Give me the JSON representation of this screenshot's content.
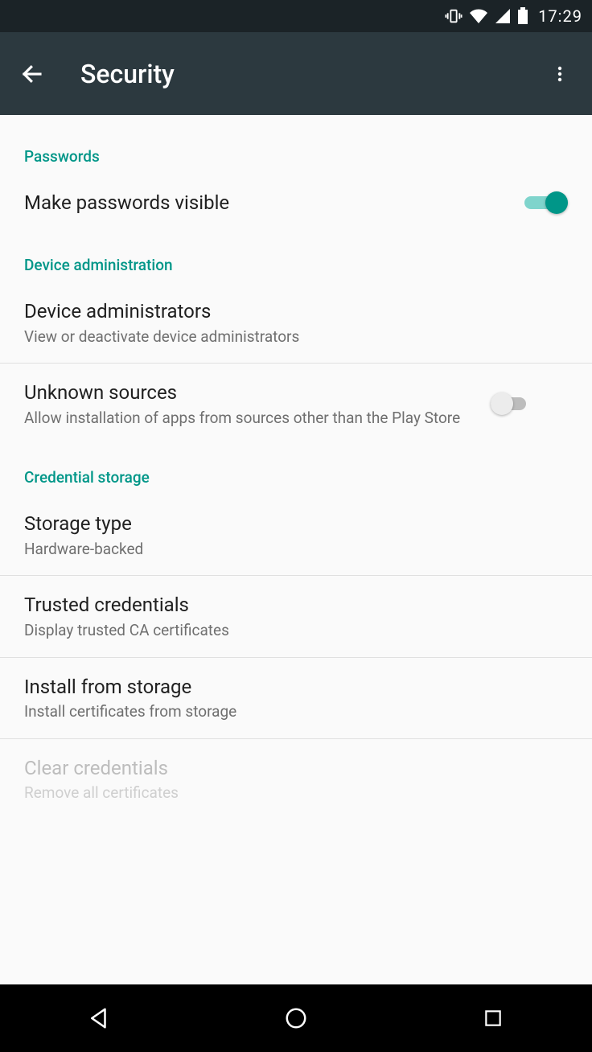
{
  "statusbar": {
    "time": "17:29"
  },
  "appbar": {
    "title": "Security"
  },
  "sections": {
    "passwords": {
      "header": "Passwords",
      "make_visible": {
        "title": "Make passwords visible",
        "on": true
      }
    },
    "device_admin": {
      "header": "Device administration",
      "administrators": {
        "title": "Device administrators",
        "summary": "View or deactivate device administrators"
      },
      "unknown_sources": {
        "title": "Unknown sources",
        "summary": "Allow installation of apps from sources other than the Play Store",
        "on": false
      }
    },
    "credential_storage": {
      "header": "Credential storage",
      "storage_type": {
        "title": "Storage type",
        "summary": "Hardware-backed"
      },
      "trusted": {
        "title": "Trusted credentials",
        "summary": "Display trusted CA certificates"
      },
      "install": {
        "title": "Install from storage",
        "summary": "Install certificates from storage"
      },
      "clear": {
        "title": "Clear credentials",
        "summary": "Remove all certificates",
        "enabled": false
      }
    }
  }
}
